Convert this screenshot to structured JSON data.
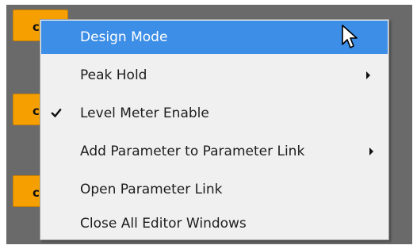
{
  "background": {
    "panel_color": "#6a6a6a",
    "block_color": "#f5a000",
    "block_letter": "c"
  },
  "menu": {
    "highlight_color": "#3d8ee6",
    "items": [
      {
        "label": "Design Mode",
        "highlighted": true,
        "checked": false,
        "submenu": false
      },
      {
        "label": "Peak Hold",
        "highlighted": false,
        "checked": false,
        "submenu": true
      },
      {
        "label": "Level Meter Enable",
        "highlighted": false,
        "checked": true,
        "submenu": false
      },
      {
        "label": "Add Parameter to Parameter Link",
        "highlighted": false,
        "checked": false,
        "submenu": true
      },
      {
        "label": "Open Parameter Link",
        "highlighted": false,
        "checked": false,
        "submenu": false
      },
      {
        "label": "Close All Editor Windows",
        "highlighted": false,
        "checked": false,
        "submenu": false
      }
    ]
  },
  "icons": {
    "check": "check-icon",
    "submenu_arrow": "chevron-right-icon",
    "cursor": "mouse-pointer-icon"
  }
}
